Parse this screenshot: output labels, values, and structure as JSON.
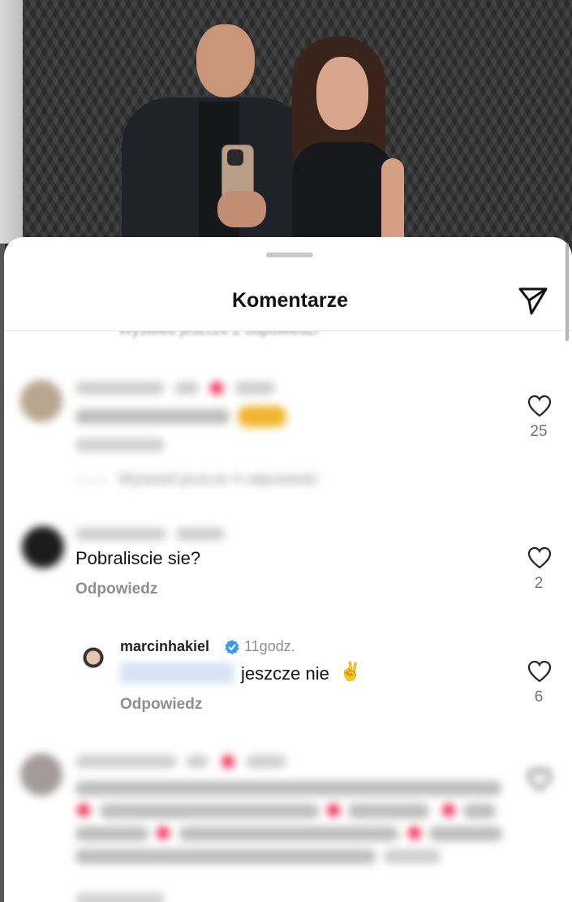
{
  "sheet": {
    "title": "Komentarze"
  },
  "comments": [
    {
      "view_replies": "Wyświetl jeszcze 2 odpowiedzi"
    },
    {
      "username": "",
      "comment": "",
      "reply_label": "Odpowiedz",
      "likes": "25",
      "view_replies": "Wyświetl jeszcze 4 odpowiedzi"
    },
    {
      "username": "",
      "comment": "Pobraliscie sie?",
      "reply_label": "Odpowiedz",
      "likes": "2"
    },
    {
      "username": "marcinhakiel",
      "time": "11godz.",
      "comment": "jeszcze nie",
      "reply_label": "Odpowiedz",
      "likes": "6"
    },
    {
      "username": "",
      "comment": "",
      "reply_label": "Odpowiedz",
      "likes": ""
    }
  ],
  "icons": {
    "send": "send-icon",
    "heart": "heart-outline-icon",
    "verified": "verified-badge-icon",
    "victory": "victory-hand-emoji"
  },
  "colors": {
    "accent_blue": "#3897f0",
    "text_secondary": "#8e8e8e",
    "heart_red": "#f0305a"
  }
}
